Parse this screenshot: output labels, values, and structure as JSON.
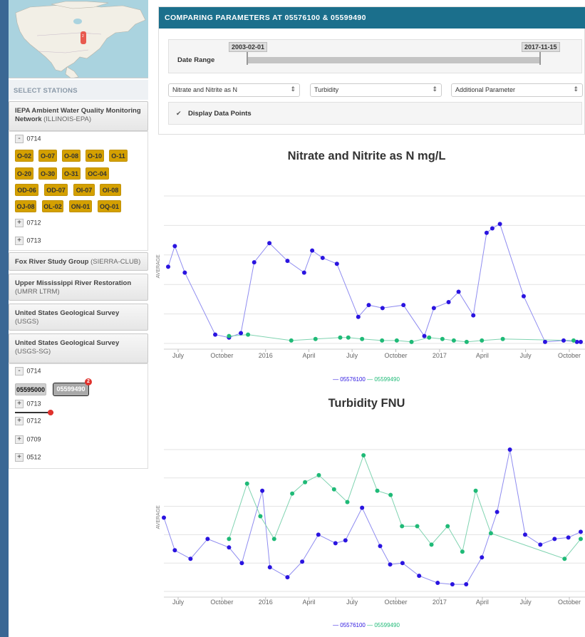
{
  "sidebar": {
    "select_title": "SELECT STATIONS",
    "networks": [
      {
        "name": "IEPA Ambient Water Quality Monitoring Network",
        "org": "(ILLINOIS-EPA)"
      },
      {
        "name": "Fox River Study Group",
        "org": "(SIERRA-CLUB)"
      },
      {
        "name": "Upper Mississippi River Restoration",
        "org": "(UMRR LTRM)"
      },
      {
        "name": "United States Geological Survey",
        "org": "(USGS)"
      },
      {
        "name": "United States Geological Survey",
        "org": "(USGS-SG)"
      }
    ],
    "iepa_hucs": [
      {
        "sign": "-",
        "code": "0714"
      },
      {
        "sign": "+",
        "code": "0712"
      },
      {
        "sign": "+",
        "code": "0713"
      }
    ],
    "iepa_stations": [
      "O-02",
      "O-07",
      "O-08",
      "O-10",
      "O-11",
      "O-20",
      "O-30",
      "O-31",
      "OC-04",
      "OD-06",
      "OD-07",
      "OI-07",
      "OI-08",
      "OJ-08",
      "OL-02",
      "ON-01",
      "OQ-01"
    ],
    "usgs_hucs": [
      {
        "sign": "-",
        "code": "0714"
      },
      {
        "sign": "+",
        "code": "0713"
      },
      {
        "sign": "+",
        "code": "0712"
      },
      {
        "sign": "+",
        "code": "0709"
      },
      {
        "sign": "+",
        "code": "0512"
      }
    ],
    "usgs_stations": [
      "05595000",
      "05599490"
    ],
    "badge_count": "2"
  },
  "header": {
    "title": "COMPARING PARAMETERS AT 05576100 & 05599490"
  },
  "date_range": {
    "label": "Date Range",
    "start": "2003-02-01",
    "end": "2017-11-15"
  },
  "selects": {
    "param1": "Nitrate and Nitrite as N",
    "param2": "Turbidity",
    "param3": "Additional Parameter"
  },
  "display_points": {
    "label": "Display Data Points",
    "checked": true
  },
  "colors": {
    "series1": "#2a14e0",
    "series2": "#1fba77",
    "series1_line": "#8f8cf0",
    "series2_line": "#7fd3b0",
    "header": "#1b6f8c",
    "chip": "#d4a000"
  },
  "chart_data": [
    {
      "type": "line",
      "title": "Nitrate and Nitrite as N mg/L",
      "ylabel": "AVERAGE",
      "x_ticks": [
        "July",
        "October",
        "2016",
        "April",
        "July",
        "October",
        "2017",
        "April",
        "July",
        "October"
      ],
      "x_tick_dates": [
        "2015-07-01",
        "2015-10-01",
        "2016-01-01",
        "2016-04-01",
        "2016-07-01",
        "2016-10-01",
        "2017-01-01",
        "2017-04-01",
        "2017-07-01",
        "2017-10-01"
      ],
      "x_range": [
        "2015-06-01",
        "2017-10-25"
      ],
      "ylim": [
        0,
        1
      ],
      "y_gridlines": 5,
      "legend": [
        "05576100",
        "05599490"
      ],
      "series": [
        {
          "name": "05576100",
          "x": [
            "2015-06-10",
            "2015-06-24",
            "2015-07-15",
            "2015-09-17",
            "2015-10-16",
            "2015-11-10",
            "2015-12-08",
            "2016-01-09",
            "2016-02-16",
            "2016-03-22",
            "2016-04-08",
            "2016-04-30",
            "2016-05-30",
            "2016-07-14",
            "2016-08-05",
            "2016-09-03",
            "2016-10-17",
            "2016-11-30",
            "2016-12-20",
            "2017-01-20",
            "2017-02-10",
            "2017-03-13",
            "2017-04-10",
            "2017-04-22",
            "2017-05-08",
            "2017-06-27",
            "2017-08-11",
            "2017-09-19",
            "2017-10-17",
            "2017-10-25"
          ],
          "y": [
            0.52,
            0.66,
            0.48,
            0.06,
            0.04,
            0.07,
            0.55,
            0.68,
            0.56,
            0.48,
            0.63,
            0.58,
            0.54,
            0.18,
            0.26,
            0.24,
            0.26,
            0.05,
            0.24,
            0.28,
            0.35,
            0.19,
            0.75,
            0.78,
            0.81,
            0.32,
            0.01,
            0.02,
            0.01,
            0.01
          ]
        },
        {
          "name": "05599490",
          "x": [
            "2015-10-16",
            "2015-11-25",
            "2016-02-24",
            "2016-04-15",
            "2016-06-06",
            "2016-06-23",
            "2016-07-22",
            "2016-09-02",
            "2016-10-03",
            "2016-11-03",
            "2016-12-10",
            "2017-01-07",
            "2017-01-31",
            "2017-02-27",
            "2017-03-31",
            "2017-05-14",
            "2017-10-10"
          ],
          "y": [
            0.05,
            0.06,
            0.02,
            0.03,
            0.04,
            0.04,
            0.03,
            0.02,
            0.02,
            0.01,
            0.04,
            0.03,
            0.02,
            0.01,
            0.02,
            0.03,
            0.02
          ]
        }
      ]
    },
    {
      "type": "line",
      "title": "Turbidity FNU",
      "ylabel": "AVERAGE",
      "x_ticks": [
        "July",
        "October",
        "2016",
        "April",
        "July",
        "October",
        "2017",
        "April",
        "July",
        "October"
      ],
      "x_tick_dates": [
        "2015-07-01",
        "2015-10-01",
        "2016-01-01",
        "2016-04-01",
        "2016-07-01",
        "2016-10-01",
        "2017-01-01",
        "2017-04-01",
        "2017-07-01",
        "2017-10-01"
      ],
      "x_range": [
        "2015-06-01",
        "2017-10-25"
      ],
      "ylim": [
        0,
        1
      ],
      "y_gridlines": 5,
      "legend": [
        "05576100",
        "05599490"
      ],
      "series": [
        {
          "name": "05576100",
          "x": [
            "2015-06-01",
            "2015-06-24",
            "2015-07-27",
            "2015-09-01",
            "2015-10-16",
            "2015-11-12",
            "2015-12-25",
            "2016-01-10",
            "2016-02-16",
            "2016-03-18",
            "2016-04-21",
            "2016-05-27",
            "2016-06-17",
            "2016-07-22",
            "2016-08-29",
            "2016-09-19",
            "2016-10-15",
            "2016-11-19",
            "2016-12-28",
            "2017-01-28",
            "2017-02-26",
            "2017-03-31",
            "2017-05-02",
            "2017-05-29",
            "2017-06-30",
            "2017-08-01",
            "2017-08-31",
            "2017-09-29",
            "2017-10-25"
          ],
          "y": [
            0.52,
            0.29,
            0.23,
            0.37,
            0.31,
            0.2,
            0.71,
            0.17,
            0.1,
            0.21,
            0.4,
            0.34,
            0.36,
            0.59,
            0.32,
            0.19,
            0.2,
            0.11,
            0.06,
            0.05,
            0.05,
            0.24,
            0.56,
            1.0,
            0.4,
            0.33,
            0.37,
            0.38,
            0.42
          ]
        },
        {
          "name": "05599490",
          "x": [
            "2015-10-16",
            "2015-11-23",
            "2015-12-21",
            "2016-01-19",
            "2016-02-26",
            "2016-03-24",
            "2016-04-22",
            "2016-05-24",
            "2016-06-21",
            "2016-07-25",
            "2016-08-23",
            "2016-09-20",
            "2016-10-14",
            "2016-11-15",
            "2016-12-15",
            "2017-01-18",
            "2017-02-18",
            "2017-03-18",
            "2017-04-19",
            "2017-09-21",
            "2017-10-25"
          ],
          "y": [
            0.37,
            0.76,
            0.53,
            0.37,
            0.69,
            0.77,
            0.82,
            0.72,
            0.63,
            0.96,
            0.71,
            0.68,
            0.46,
            0.46,
            0.33,
            0.46,
            0.28,
            0.71,
            0.41,
            0.23,
            0.37
          ]
        }
      ]
    }
  ]
}
